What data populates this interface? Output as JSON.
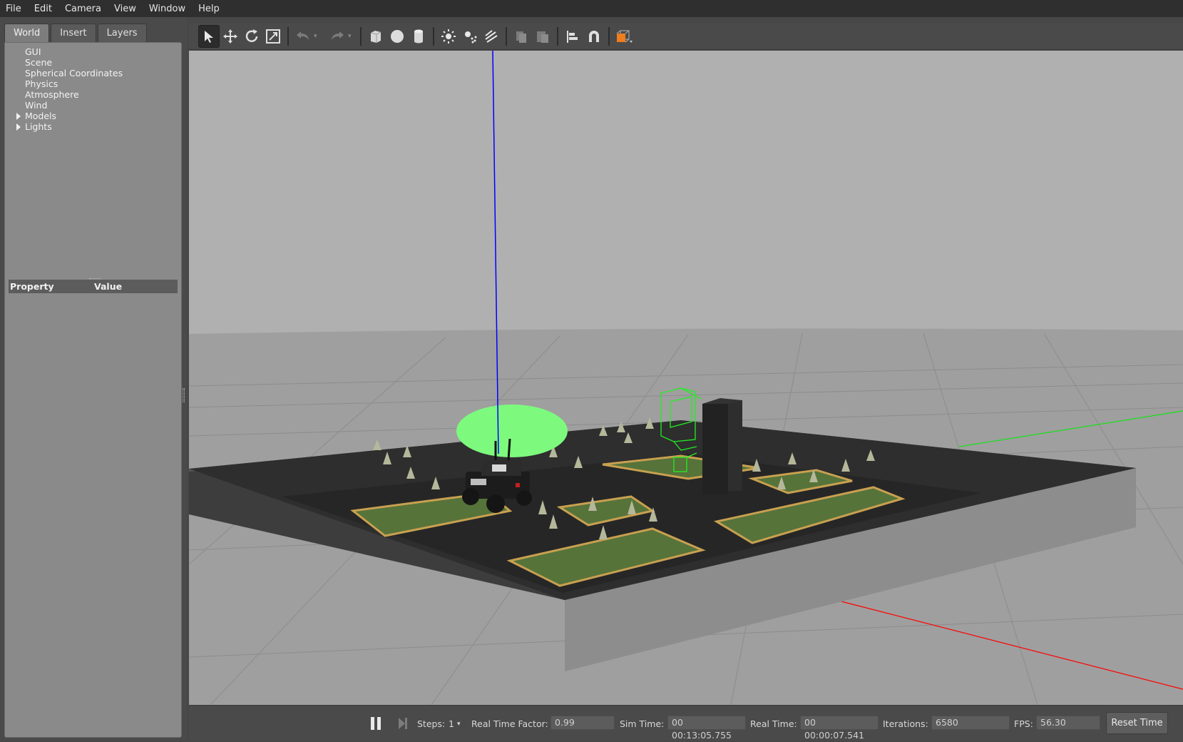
{
  "menu": [
    "File",
    "Edit",
    "Camera",
    "View",
    "Window",
    "Help"
  ],
  "tabs": {
    "world": "World",
    "insert": "Insert",
    "layers": "Layers"
  },
  "tree": {
    "gui": "GUI",
    "scene": "Scene",
    "spherical": "Spherical Coordinates",
    "physics": "Physics",
    "atmosphere": "Atmosphere",
    "wind": "Wind",
    "models": "Models",
    "lights": "Lights"
  },
  "properties": {
    "col_property": "Property",
    "col_value": "Value"
  },
  "toolbar_icons": [
    "select-arrow-icon",
    "translate-icon",
    "rotate-icon",
    "scale-icon",
    "undo-icon",
    "redo-icon",
    "box-shape-icon",
    "sphere-shape-icon",
    "cylinder-shape-icon",
    "point-light-icon",
    "spot-light-icon",
    "directional-light-icon",
    "copy-icon",
    "paste-icon",
    "align-icon",
    "snap-magnet-icon",
    "view-angle-icon"
  ],
  "status": {
    "steps_label": "Steps:",
    "steps_value": "1",
    "rtf_label": "Real Time Factor:",
    "rtf_value": "0.99",
    "sim_time_label": "Sim Time:",
    "sim_time_value": "00 00:13:05.755",
    "real_time_label": "Real Time:",
    "real_time_value": "00 00:00:07.541",
    "iterations_label": "Iterations:",
    "iterations_value": "6580",
    "fps_label": "FPS:",
    "fps_value": "56.30",
    "reset_label": "Reset Time"
  },
  "colors": {
    "sky": "#b0b0b0",
    "ground": "#9e9e9e",
    "wall": "#3e3e3e",
    "grass": "#5a7a3a",
    "axis_z": "#0000ff",
    "axis_x": "#ff0000",
    "axis_y": "#00ff00",
    "selection": "#00ff00"
  }
}
